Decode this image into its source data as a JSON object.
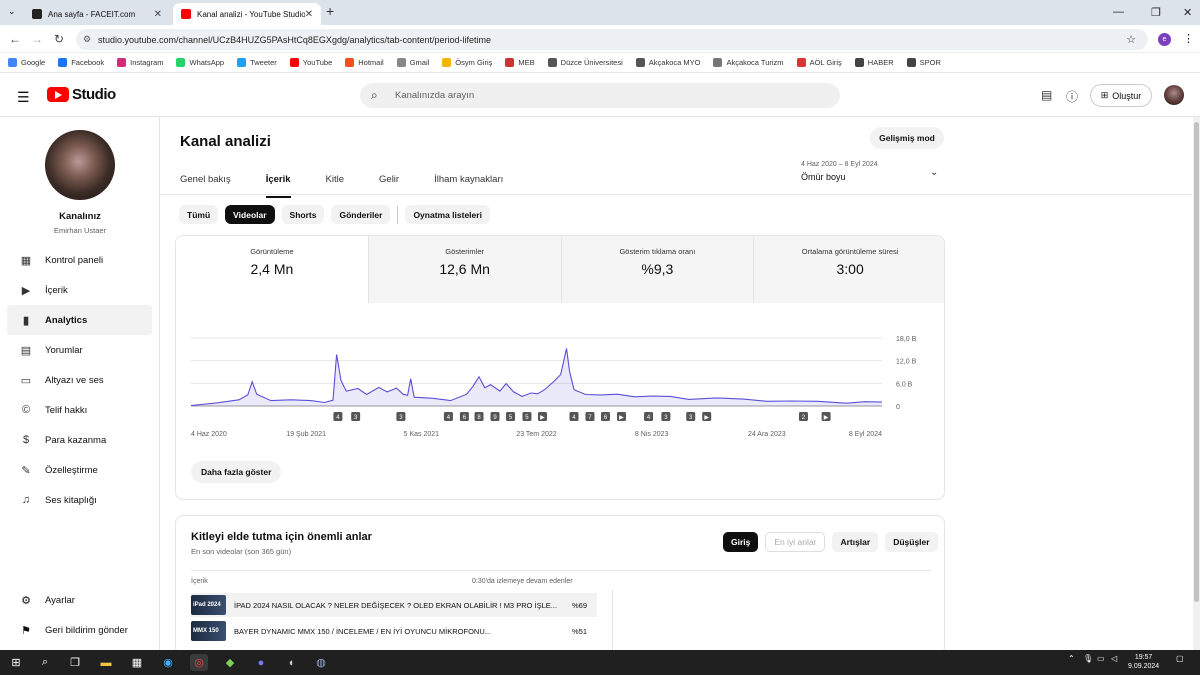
{
  "browser": {
    "tabs": [
      {
        "title": "Ana sayfa - FACEIT.com",
        "color": "#ff5500"
      },
      {
        "title": "Kanal analizi - YouTube Studio",
        "color": "#ff0000"
      }
    ],
    "url": "studio.youtube.com/channel/UCzB4HUZG5PAsHtCq8EGXgdg/analytics/tab-content/period-lifetime",
    "profile_initial": "e",
    "bookmarks": [
      {
        "label": "Google",
        "color": "#4285f4"
      },
      {
        "label": "Facebook",
        "color": "#1877f2"
      },
      {
        "label": "Instagram",
        "color": "#d62976"
      },
      {
        "label": "WhatsApp",
        "color": "#25d366"
      },
      {
        "label": "Tweeter",
        "color": "#1da1f2"
      },
      {
        "label": "YouTube",
        "color": "#ff0000"
      },
      {
        "label": "Hotmail",
        "color": "#f25022"
      },
      {
        "label": "Gmail",
        "color": "#888888"
      },
      {
        "label": "Ösym Giriş",
        "color": "#f4b400"
      },
      {
        "label": "MEB",
        "color": "#cc3333"
      },
      {
        "label": "Düzce Üniversitesi",
        "color": "#555555"
      },
      {
        "label": "Akçakoca MYO",
        "color": "#555555"
      },
      {
        "label": "Akçakoca Turizm",
        "color": "#777777"
      },
      {
        "label": "AÖL Giriş",
        "color": "#d33"
      },
      {
        "label": "HABER",
        "color": "#444444"
      },
      {
        "label": "SPOR",
        "color": "#444444"
      }
    ]
  },
  "header": {
    "logo_text": "Studio",
    "search_placeholder": "Kanalınızda arayın",
    "create_label": "Oluştur"
  },
  "sidebar": {
    "channel_title": "Kanalınız",
    "channel_name": "Emirhan Ustaer",
    "items": [
      {
        "label": "Kontrol paneli",
        "icon": "dashboard-icon",
        "glyph": "▦"
      },
      {
        "label": "İçerik",
        "icon": "content-icon",
        "glyph": "▶"
      },
      {
        "label": "Analytics",
        "icon": "analytics-icon",
        "glyph": "▮"
      },
      {
        "label": "Yorumlar",
        "icon": "comments-icon",
        "glyph": "▤"
      },
      {
        "label": "Altyazı ve ses",
        "icon": "subtitles-icon",
        "glyph": "▭"
      },
      {
        "label": "Telif hakkı",
        "icon": "copyright-icon",
        "glyph": "©"
      },
      {
        "label": "Para kazanma",
        "icon": "monetization-icon",
        "glyph": "$"
      },
      {
        "label": "Özelleştirme",
        "icon": "customization-icon",
        "glyph": "✎"
      },
      {
        "label": "Ses kitaplığı",
        "icon": "audio-library-icon",
        "glyph": "♫"
      }
    ],
    "settings_label": "Ayarlar",
    "feedback_label": "Geri bildirim gönder"
  },
  "main": {
    "title": "Kanal analizi",
    "advanced_label": "Gelişmiş mod",
    "tabs": [
      "Genel bakış",
      "İçerik",
      "Kitle",
      "Gelir",
      "İlham kaynakları"
    ],
    "active_tab": 1,
    "date_range": "4 Haz 2020 – 8 Eyl 2024",
    "period": "Ömür boyu",
    "chips": [
      "Tümü",
      "Videolar",
      "Shorts",
      "Gönderiler",
      "Oynatma listeleri"
    ],
    "active_chip": 1,
    "metrics": [
      {
        "label": "Görüntüleme",
        "value": "2,4 Mn"
      },
      {
        "label": "Gösterimler",
        "value": "12,6 Mn"
      },
      {
        "label": "Gösterim tıklama oranı",
        "value": "%9,3"
      },
      {
        "label": "Ortalama görüntüleme süresi",
        "value": "3:00"
      }
    ],
    "show_more": "Daha fazla göster",
    "retention": {
      "title": "Kitleyi elde tutma için önemli anlar",
      "subtitle": "En son videolar (son 365 gün)",
      "buttons": [
        "Giriş",
        "En iyi anlar",
        "Artışlar",
        "Düşüşler"
      ],
      "col_content": "İçerik",
      "col_metric": "0:30'da izlemeye devam edenler",
      "rows": [
        {
          "title": "İPAD 2024 NASIL OLACAK ? NELER DEĞİŞECEK ? OLED EKRAN OLABİLİR ! M3 PRO İŞLE...",
          "pct": "%69",
          "thumb": "iPad 2024"
        },
        {
          "title": "BAYER DYNAMIC MMX 150 / İNCELEME / EN İYİ OYUNCU MİKROFONU...",
          "pct": "%51",
          "thumb": "MMX 150"
        }
      ]
    }
  },
  "chart_data": {
    "type": "line",
    "x_labels": [
      "4 Haz 2020",
      "19 Şub 2021",
      "5 Kas 2021",
      "23 Tem 2022",
      "8 Nis 2023",
      "24 Ara 2023",
      "8 Eyl 2024"
    ],
    "y_tick_labels": [
      "18,0 B",
      "12,0 B",
      "6,0 B",
      "0"
    ],
    "ylim": [
      0,
      18000
    ],
    "color": "#5b4fd6",
    "x_start": "2020-06-04",
    "x_end": "2024-09-08",
    "series": [
      {
        "points": [
          [
            "2020-06-04",
            400
          ],
          [
            "2020-08-01",
            700
          ],
          [
            "2020-09-20",
            1500
          ],
          [
            "2020-10-10",
            3200
          ],
          [
            "2020-10-20",
            6300
          ],
          [
            "2020-10-30",
            3000
          ],
          [
            "2020-12-01",
            1700
          ],
          [
            "2021-01-15",
            1500
          ],
          [
            "2021-03-01",
            1300
          ],
          [
            "2021-04-01",
            1200
          ],
          [
            "2021-04-20",
            1400
          ],
          [
            "2021-04-28",
            13500
          ],
          [
            "2021-05-08",
            7000
          ],
          [
            "2021-05-20",
            3800
          ],
          [
            "2021-06-15",
            4500
          ],
          [
            "2021-07-05",
            3300
          ],
          [
            "2021-08-01",
            4800
          ],
          [
            "2021-08-20",
            3600
          ],
          [
            "2021-09-10",
            5000
          ],
          [
            "2021-09-25",
            3000
          ],
          [
            "2021-10-05",
            2700
          ],
          [
            "2021-10-12",
            7500
          ],
          [
            "2021-10-20",
            2200
          ],
          [
            "2021-12-01",
            1900
          ],
          [
            "2022-01-10",
            1700
          ],
          [
            "2022-02-15",
            3000
          ],
          [
            "2022-03-01",
            5000
          ],
          [
            "2022-03-15",
            8000
          ],
          [
            "2022-03-28",
            4700
          ],
          [
            "2022-04-10",
            5500
          ],
          [
            "2022-05-01",
            4200
          ],
          [
            "2022-05-15",
            5800
          ],
          [
            "2022-06-01",
            3600
          ],
          [
            "2022-06-20",
            2800
          ],
          [
            "2022-07-10",
            3300
          ],
          [
            "2022-07-25",
            3100
          ],
          [
            "2022-08-10",
            4600
          ],
          [
            "2022-09-01",
            6500
          ],
          [
            "2022-09-15",
            8200
          ],
          [
            "2022-09-28",
            15500
          ],
          [
            "2022-10-05",
            9000
          ],
          [
            "2022-10-15",
            4200
          ],
          [
            "2022-11-10",
            3300
          ],
          [
            "2022-12-15",
            2800
          ],
          [
            "2023-01-20",
            3000
          ],
          [
            "2023-03-01",
            2700
          ],
          [
            "2023-04-08",
            2500
          ],
          [
            "2023-05-20",
            2400
          ],
          [
            "2023-07-01",
            2000
          ],
          [
            "2023-09-01",
            2000
          ],
          [
            "2023-11-01",
            1700
          ],
          [
            "2023-12-24",
            1500
          ],
          [
            "2024-02-15",
            1200
          ],
          [
            "2024-04-15",
            1100
          ],
          [
            "2024-06-20",
            1000
          ],
          [
            "2024-08-01",
            1000
          ],
          [
            "2024-09-08",
            900
          ]
        ]
      }
    ],
    "markers": [
      {
        "date": "2021-05-01",
        "label": "4"
      },
      {
        "date": "2021-06-10",
        "label": "3"
      },
      {
        "date": "2021-09-20",
        "label": "3"
      },
      {
        "date": "2022-01-05",
        "label": "4"
      },
      {
        "date": "2022-02-10",
        "label": "6"
      },
      {
        "date": "2022-03-15",
        "label": "8"
      },
      {
        "date": "2022-04-20",
        "label": "9"
      },
      {
        "date": "2022-05-25",
        "label": "5"
      },
      {
        "date": "2022-07-01",
        "label": "5"
      },
      {
        "date": "2022-08-05",
        "label": "▶"
      },
      {
        "date": "2022-10-15",
        "label": "4"
      },
      {
        "date": "2022-11-20",
        "label": "7"
      },
      {
        "date": "2022-12-25",
        "label": "6"
      },
      {
        "date": "2023-01-30",
        "label": "▶"
      },
      {
        "date": "2023-04-01",
        "label": "4"
      },
      {
        "date": "2023-05-10",
        "label": "3"
      },
      {
        "date": "2023-07-05",
        "label": "3"
      },
      {
        "date": "2023-08-10",
        "label": "▶"
      },
      {
        "date": "2024-03-15",
        "label": "2"
      },
      {
        "date": "2024-05-05",
        "label": "▶"
      }
    ]
  },
  "taskbar": {
    "time": "19:57",
    "date": "9.09.2024"
  }
}
